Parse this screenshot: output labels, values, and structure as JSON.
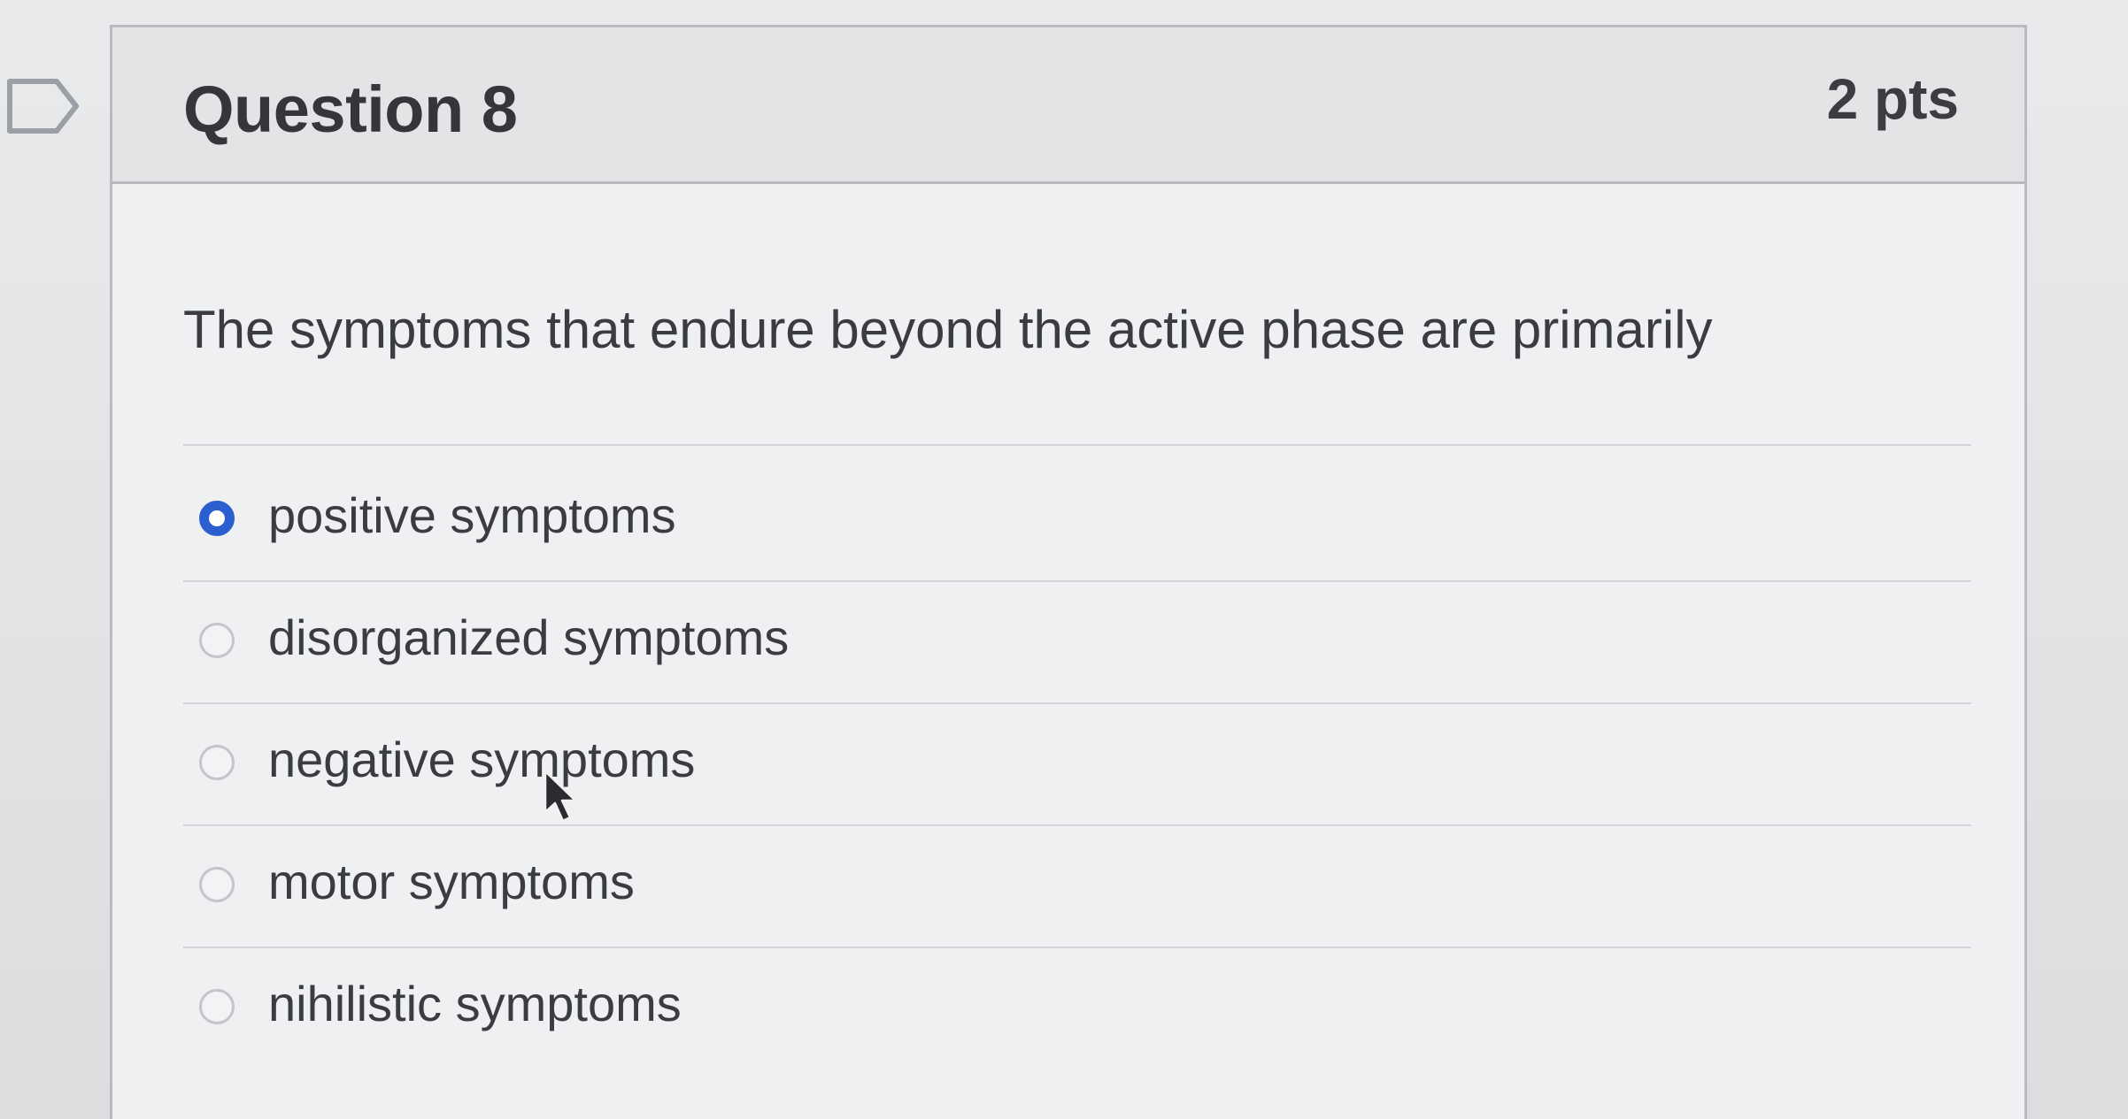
{
  "question": {
    "title": "Question 8",
    "points": "2 pts",
    "text": "The symptoms that endure beyond the active phase are primarily"
  },
  "answers": [
    {
      "label": "positive symptoms",
      "selected": true
    },
    {
      "label": "disorganized symptoms",
      "selected": false
    },
    {
      "label": "negative symptoms",
      "selected": false
    },
    {
      "label": "motor symptoms",
      "selected": false
    },
    {
      "label": "nihilistic symptoms",
      "selected": false
    }
  ],
  "colors": {
    "accent": "#2b5fd0",
    "text": "#3a3c40",
    "card_background": "#eef0f2",
    "header_background": "#e3e4e6"
  },
  "icons": {
    "flag": "flag-question-icon",
    "cursor": "mouse-pointer-icon"
  }
}
